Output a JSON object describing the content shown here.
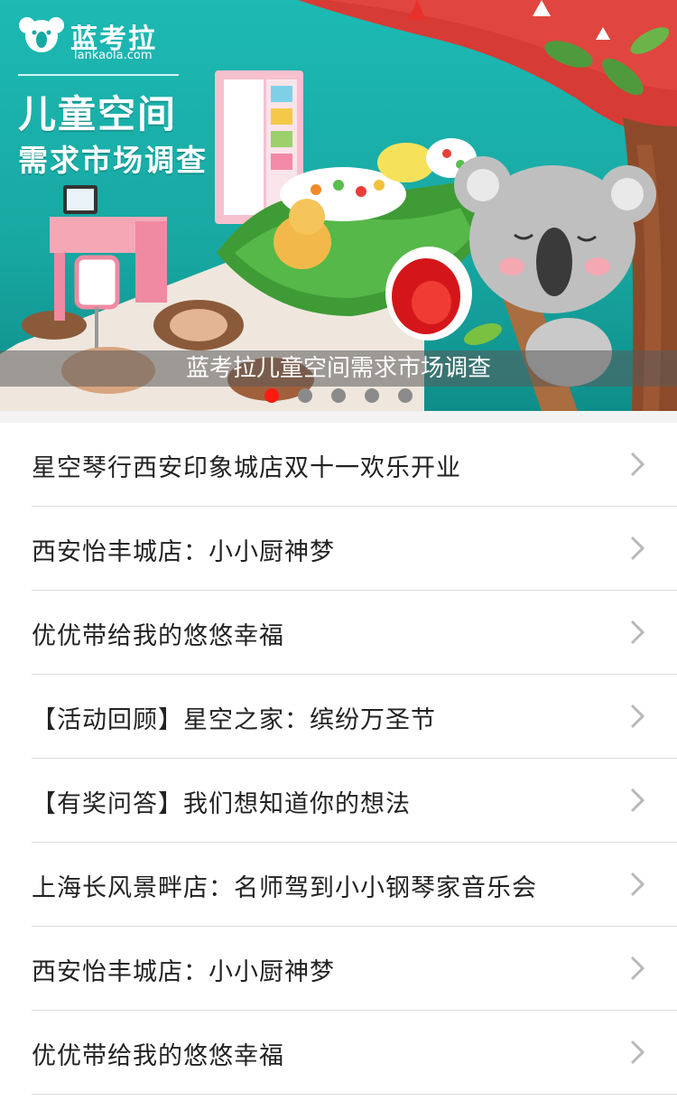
{
  "banner": {
    "brand": "蓝考拉",
    "domain": "lankaola.com",
    "headline_line1": "儿童空间",
    "headline_line2": "需求市场调查",
    "caption": "蓝考拉儿童空间需求市场调查",
    "slide_count": 5,
    "active_slide": 1,
    "dot_active_color": "#ff1a12",
    "dot_color": "#8b8b8b"
  },
  "list": {
    "items": [
      {
        "title": "星空琴行西安印象城店双十一欢乐开业"
      },
      {
        "title": "西安怡丰城店：小小厨神梦"
      },
      {
        "title": "优优带给我的悠悠幸福"
      },
      {
        "title": "【活动回顾】星空之家：缤纷万圣节"
      },
      {
        "title": "【有奖问答】我们想知道你的想法"
      },
      {
        "title": "上海长风景畔店：名师驾到小小钢琴家音乐会"
      },
      {
        "title": "西安怡丰城店：小小厨神梦"
      },
      {
        "title": "优优带给我的悠悠幸福"
      }
    ]
  },
  "icons": {
    "row_arrow": "chevron-right-icon",
    "brand_logo": "koala-logo-icon"
  }
}
